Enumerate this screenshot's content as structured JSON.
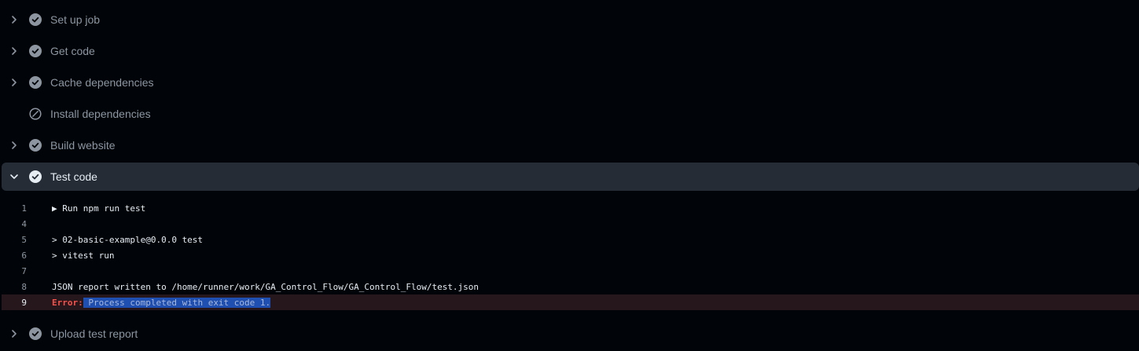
{
  "steps": [
    {
      "label": "Set up job",
      "status": "success-icon",
      "chevron": "chevron-right-icon"
    },
    {
      "label": "Get code",
      "status": "success-icon",
      "chevron": "chevron-right-icon"
    },
    {
      "label": "Cache dependencies",
      "status": "success-icon",
      "chevron": "chevron-right-icon"
    },
    {
      "label": "Install dependencies",
      "status": "skipped-icon",
      "chevron": ""
    },
    {
      "label": "Build website",
      "status": "success-icon",
      "chevron": "chevron-right-icon"
    },
    {
      "label": "Test code",
      "status": "success-icon",
      "chevron": "chevron-down-icon",
      "expanded": true
    },
    {
      "label": "Upload test report",
      "status": "success-icon",
      "chevron": "chevron-right-icon"
    }
  ],
  "log": [
    {
      "num": "1",
      "text": "▶ Run npm run test"
    },
    {
      "num": "4",
      "text": ""
    },
    {
      "num": "5",
      "text": "> 02-basic-example@0.0.0 test"
    },
    {
      "num": "6",
      "text": "> vitest run"
    },
    {
      "num": "7",
      "text": ""
    },
    {
      "num": "8",
      "text": "JSON report written to /home/runner/work/GA_Control_Flow/GA_Control_Flow/test.json"
    },
    {
      "num": "9",
      "error_prefix_a": "Error",
      "error_prefix_b": ":",
      "text": " Process completed with exit code 1."
    }
  ],
  "colors": {
    "background": "#010409",
    "active_row": "#262c36",
    "error_row": "#25171c",
    "error_text": "#f85149",
    "selection": "#1f4fb0"
  }
}
